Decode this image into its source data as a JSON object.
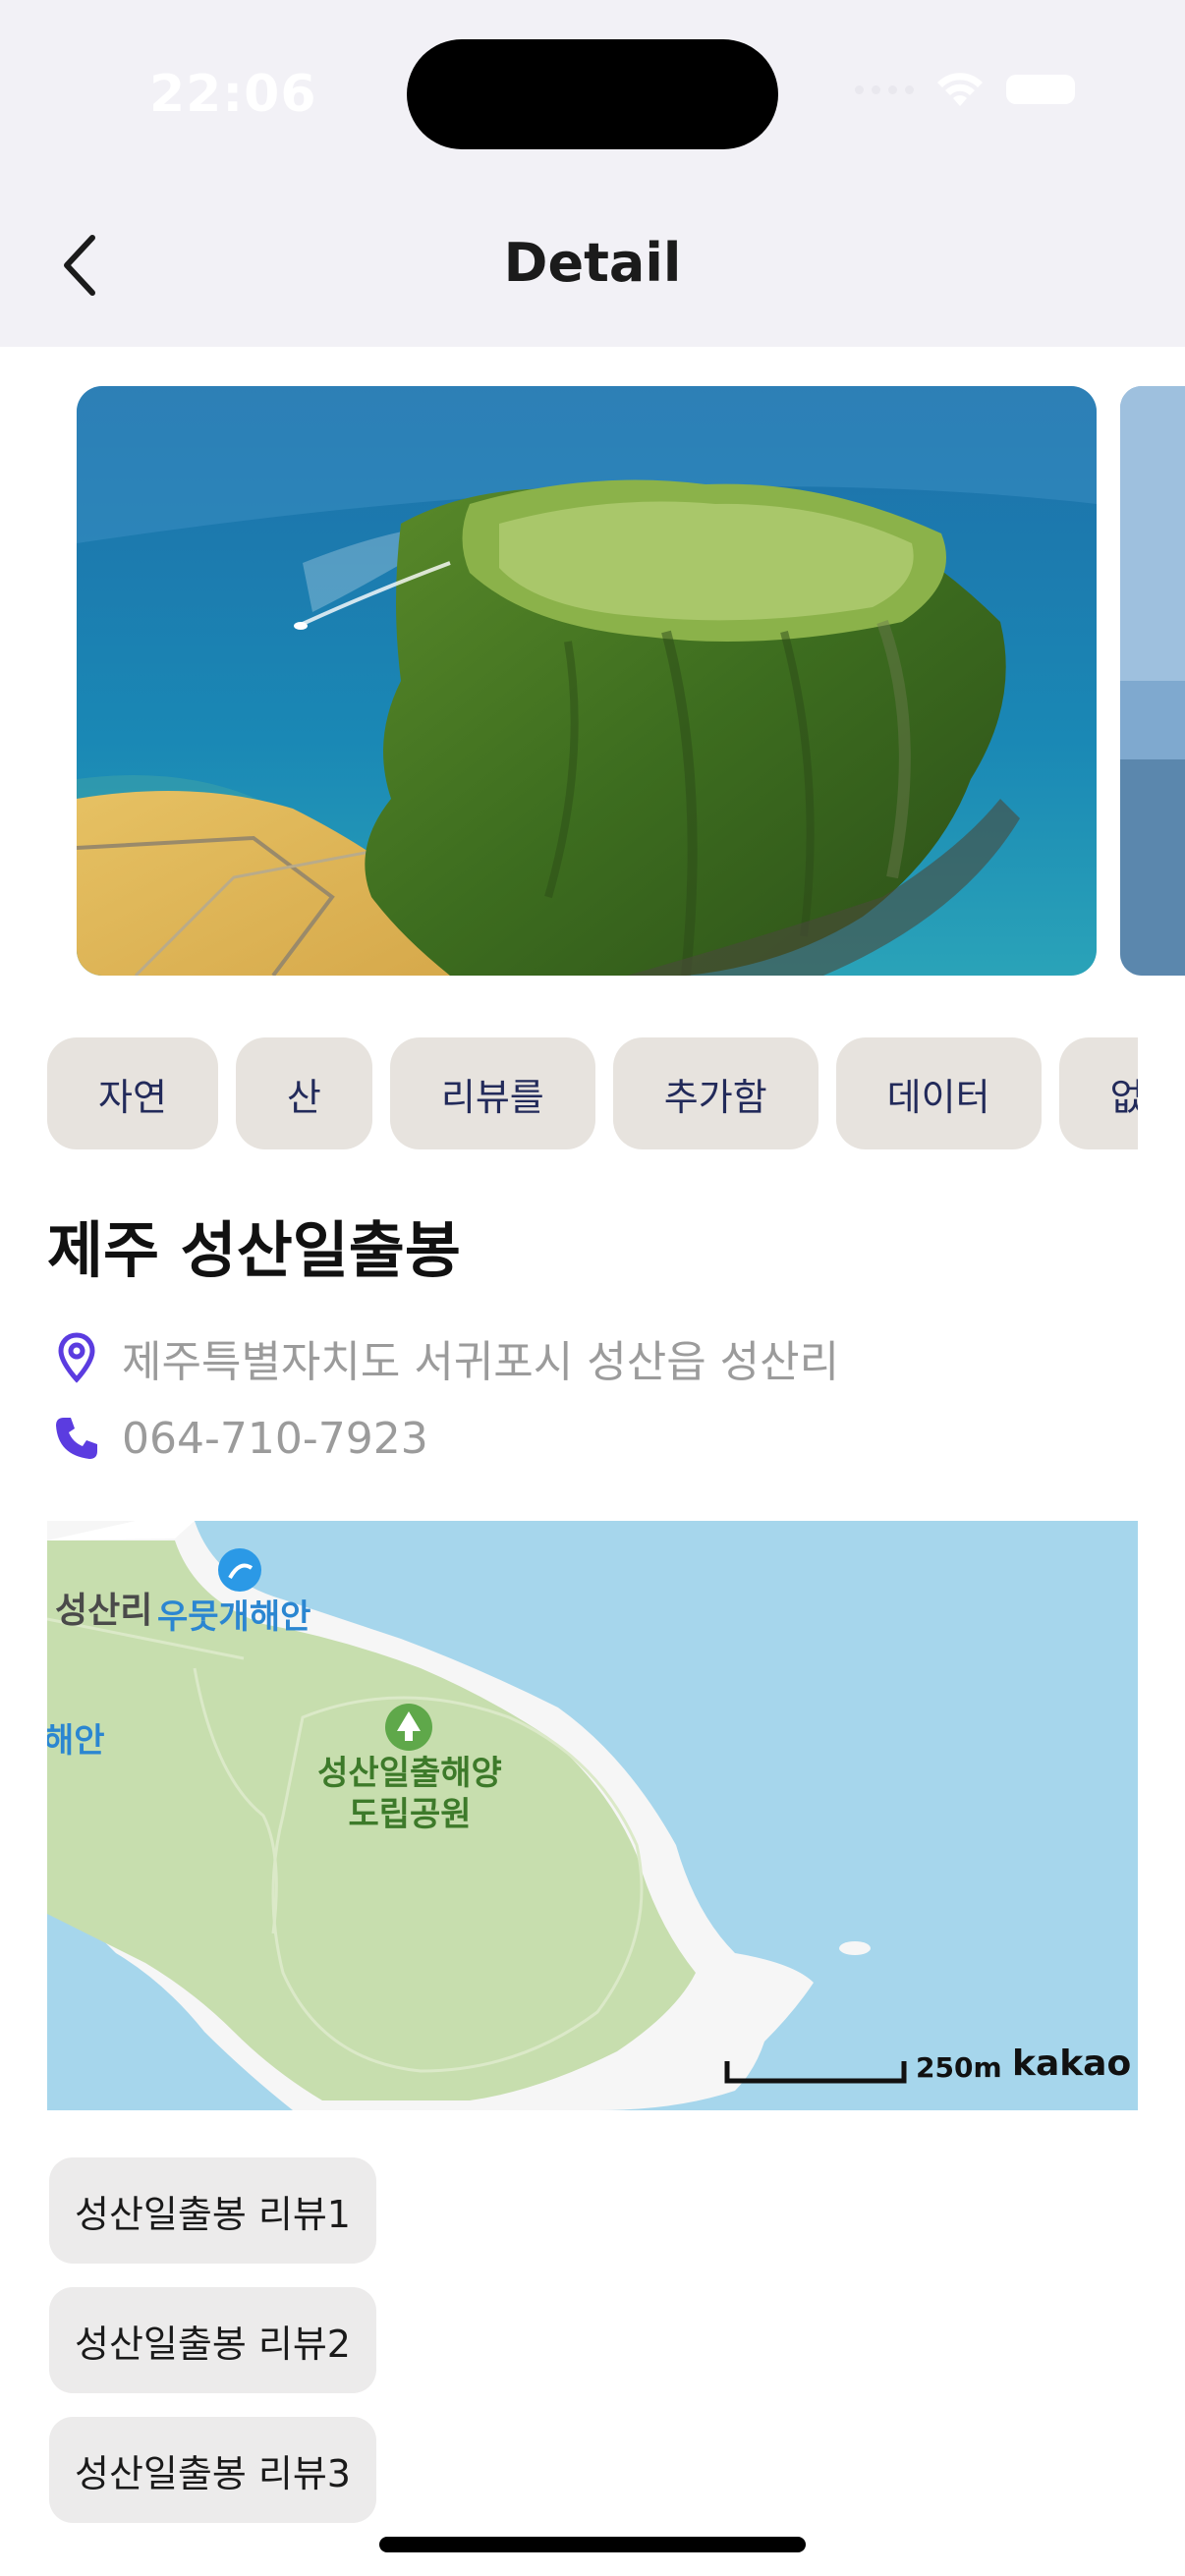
{
  "status_bar": {
    "time": "22:06"
  },
  "nav": {
    "title": "Detail"
  },
  "tags": [
    "자연",
    "산",
    "리뷰를",
    "추가함",
    "데이터",
    "없음"
  ],
  "place": {
    "name": "제주 성산일출봉",
    "address": "제주특별자치도 서귀포시 성산읍 성산리",
    "phone": "064-710-7923"
  },
  "map": {
    "labels": {
      "village": "성산리",
      "beach": "우뭇개해안",
      "coast_left": "해안",
      "park_line1": "성산일출해양",
      "park_line2": "도립공원"
    },
    "scale": "250m",
    "brand": "kakao",
    "colors": {
      "water": "#a6d6ec",
      "land": "#c7deae",
      "shore": "#ffffff"
    }
  },
  "reviews": [
    "성산일출봉 리뷰1",
    "성산일출봉 리뷰2",
    "성산일출봉 리뷰3"
  ],
  "icons": {
    "back": "chevron-left-icon",
    "location": "location-pin-icon",
    "phone": "phone-icon"
  },
  "colors": {
    "accent": "#5b3ce0",
    "tag_bg": "#e7e3de",
    "tag_text": "#222a5a"
  }
}
